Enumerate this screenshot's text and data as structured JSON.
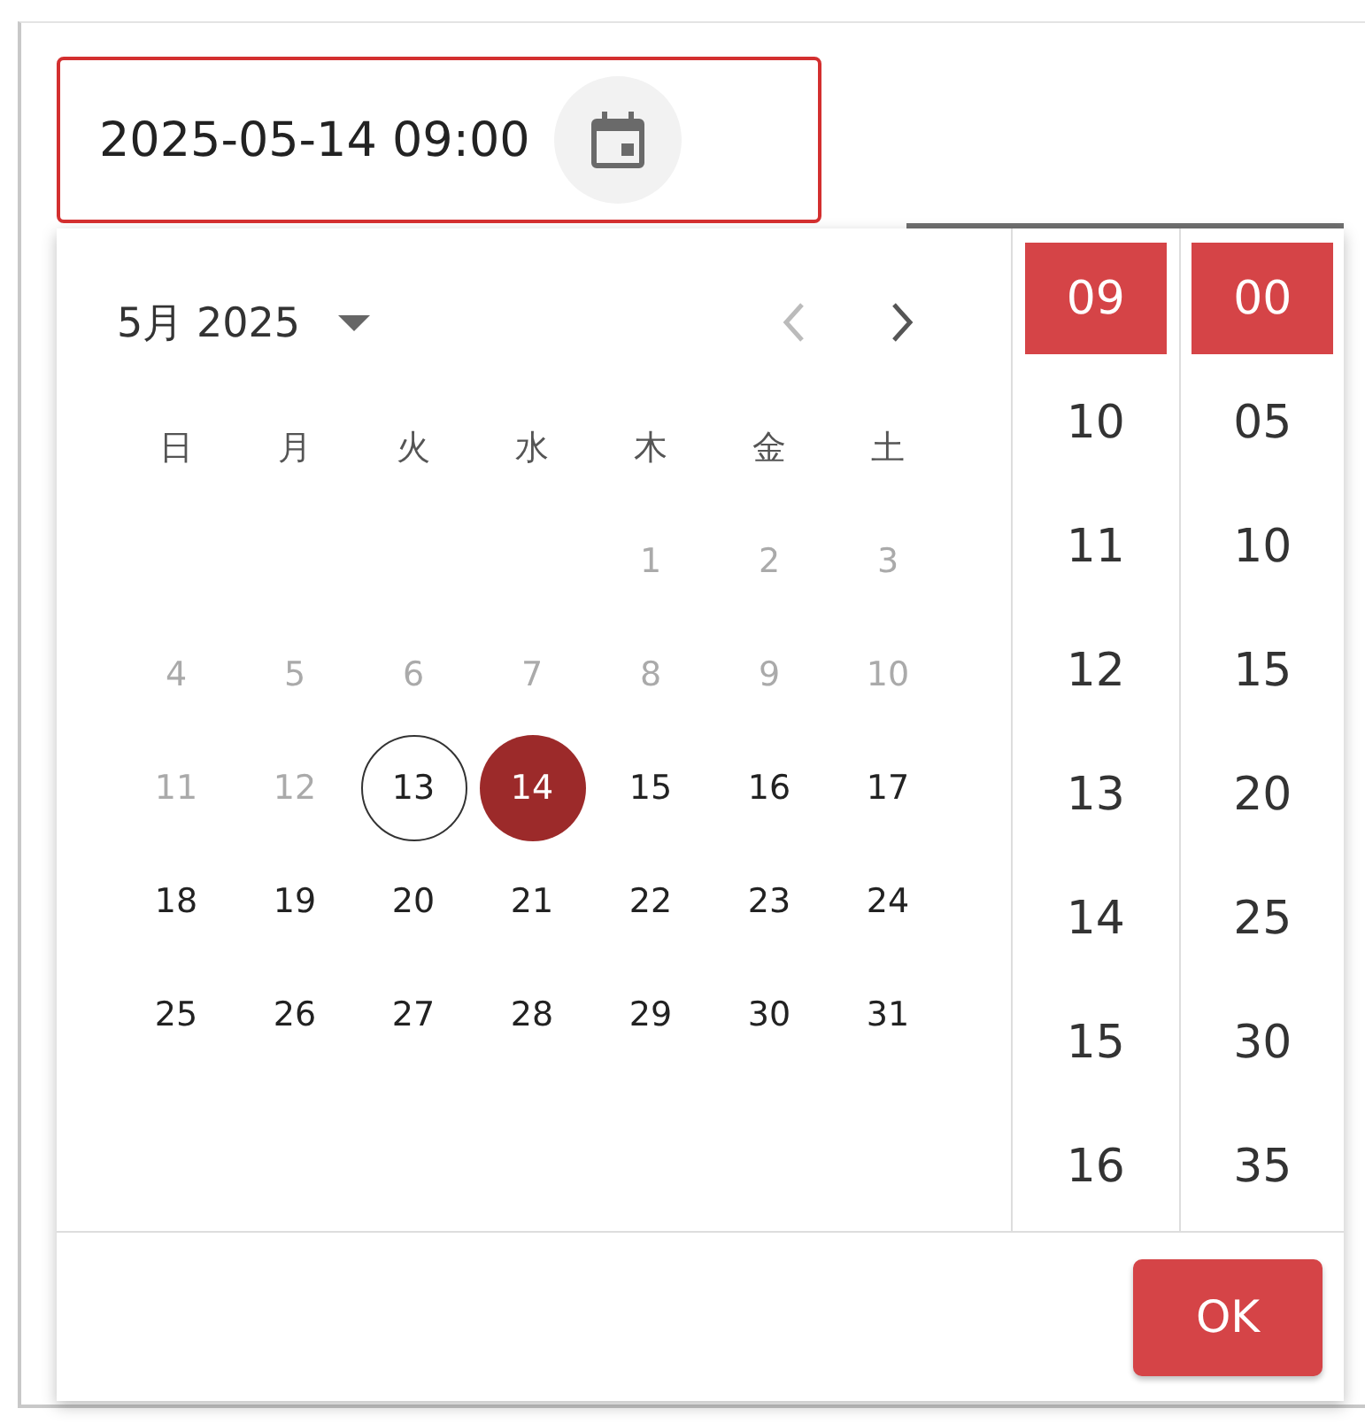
{
  "field": {
    "value": "2025-05-14 09:00"
  },
  "calendar": {
    "month_label": "5月 2025",
    "weekdays": [
      "日",
      "月",
      "火",
      "水",
      "木",
      "金",
      "土"
    ],
    "weeks": [
      {
        "days": [
          {
            "label": "1",
            "disabled": true,
            "today": false,
            "selected": false
          },
          {
            "label": "2",
            "disabled": true,
            "today": false,
            "selected": false
          },
          {
            "label": "3",
            "disabled": true,
            "today": false,
            "selected": false
          }
        ]
      },
      {
        "days": [
          {
            "label": "4",
            "disabled": true,
            "today": false,
            "selected": false
          },
          {
            "label": "5",
            "disabled": true,
            "today": false,
            "selected": false
          },
          {
            "label": "6",
            "disabled": true,
            "today": false,
            "selected": false
          },
          {
            "label": "7",
            "disabled": true,
            "today": false,
            "selected": false
          },
          {
            "label": "8",
            "disabled": true,
            "today": false,
            "selected": false
          },
          {
            "label": "9",
            "disabled": true,
            "today": false,
            "selected": false
          },
          {
            "label": "10",
            "disabled": true,
            "today": false,
            "selected": false
          }
        ]
      },
      {
        "days": [
          {
            "label": "11",
            "disabled": true,
            "today": false,
            "selected": false
          },
          {
            "label": "12",
            "disabled": true,
            "today": false,
            "selected": false
          },
          {
            "label": "13",
            "disabled": false,
            "today": true,
            "selected": false
          },
          {
            "label": "14",
            "disabled": false,
            "today": false,
            "selected": true
          },
          {
            "label": "15",
            "disabled": false,
            "today": false,
            "selected": false
          },
          {
            "label": "16",
            "disabled": false,
            "today": false,
            "selected": false
          },
          {
            "label": "17",
            "disabled": false,
            "today": false,
            "selected": false
          }
        ]
      },
      {
        "days": [
          {
            "label": "18",
            "disabled": false,
            "today": false,
            "selected": false
          },
          {
            "label": "19",
            "disabled": false,
            "today": false,
            "selected": false
          },
          {
            "label": "20",
            "disabled": false,
            "today": false,
            "selected": false
          },
          {
            "label": "21",
            "disabled": false,
            "today": false,
            "selected": false
          },
          {
            "label": "22",
            "disabled": false,
            "today": false,
            "selected": false
          },
          {
            "label": "23",
            "disabled": false,
            "today": false,
            "selected": false
          },
          {
            "label": "24",
            "disabled": false,
            "today": false,
            "selected": false
          }
        ]
      },
      {
        "days": [
          {
            "label": "25",
            "disabled": false,
            "today": false,
            "selected": false
          },
          {
            "label": "26",
            "disabled": false,
            "today": false,
            "selected": false
          },
          {
            "label": "27",
            "disabled": false,
            "today": false,
            "selected": false
          },
          {
            "label": "28",
            "disabled": false,
            "today": false,
            "selected": false
          },
          {
            "label": "29",
            "disabled": false,
            "today": false,
            "selected": false
          },
          {
            "label": "30",
            "disabled": false,
            "today": false,
            "selected": false
          },
          {
            "label": "31",
            "disabled": false,
            "today": false,
            "selected": false
          }
        ]
      }
    ]
  },
  "hours": [
    {
      "label": "09",
      "selected": true
    },
    {
      "label": "10",
      "selected": false
    },
    {
      "label": "11",
      "selected": false
    },
    {
      "label": "12",
      "selected": false
    },
    {
      "label": "13",
      "selected": false
    },
    {
      "label": "14",
      "selected": false
    },
    {
      "label": "15",
      "selected": false
    },
    {
      "label": "16",
      "selected": false
    }
  ],
  "minutes": [
    {
      "label": "00",
      "selected": true
    },
    {
      "label": "05",
      "selected": false
    },
    {
      "label": "10",
      "selected": false
    },
    {
      "label": "15",
      "selected": false
    },
    {
      "label": "20",
      "selected": false
    },
    {
      "label": "25",
      "selected": false
    },
    {
      "label": "30",
      "selected": false
    },
    {
      "label": "35",
      "selected": false
    }
  ],
  "ok_button": {
    "label": "OK"
  }
}
